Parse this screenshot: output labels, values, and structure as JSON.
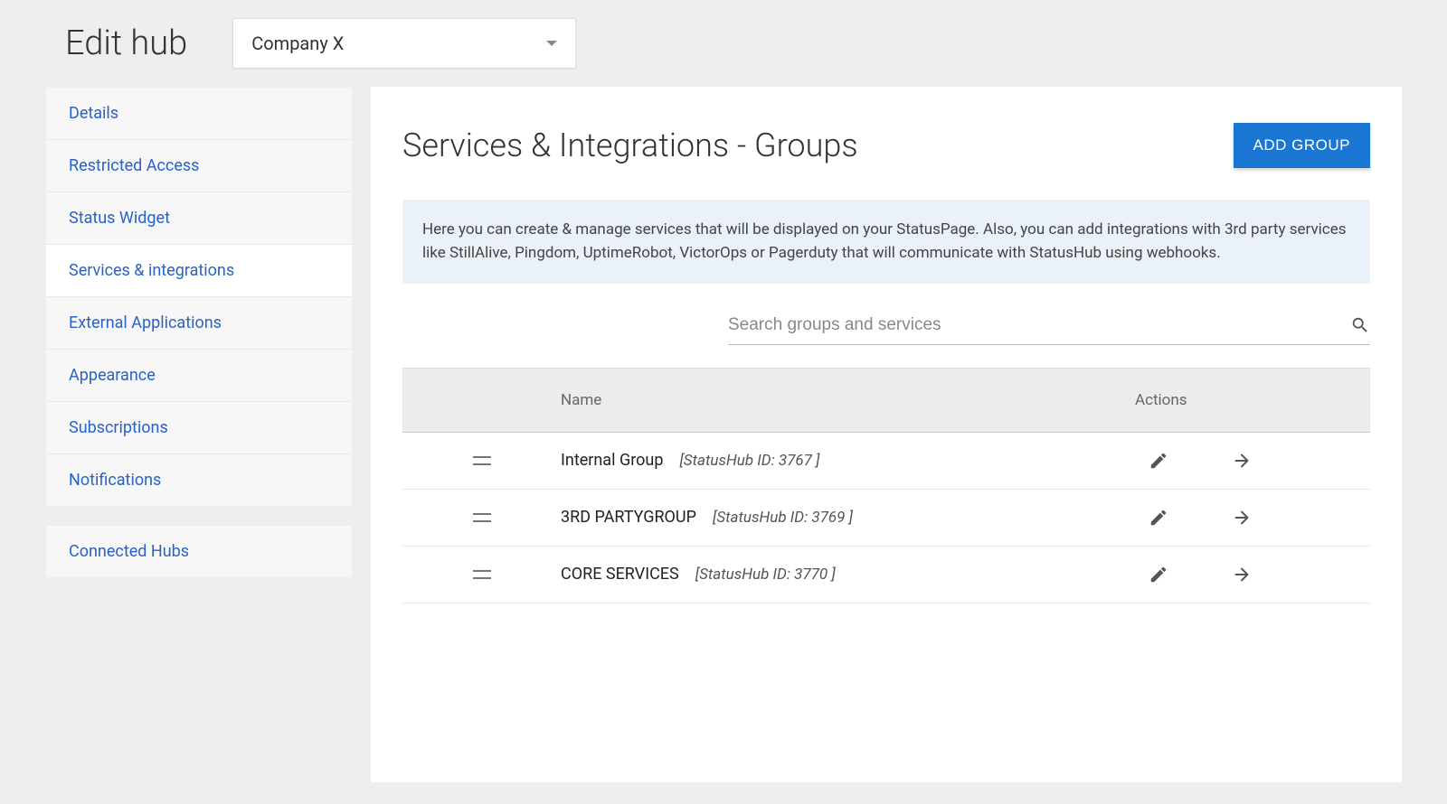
{
  "header": {
    "title": "Edit hub",
    "company": "Company X"
  },
  "sidebar": {
    "group1": [
      {
        "label": "Details",
        "active": false
      },
      {
        "label": "Restricted Access",
        "active": false
      },
      {
        "label": "Status Widget",
        "active": false
      },
      {
        "label": "Services & integrations",
        "active": true
      },
      {
        "label": "External Applications",
        "active": false
      },
      {
        "label": "Appearance",
        "active": false
      },
      {
        "label": "Subscriptions",
        "active": false
      },
      {
        "label": "Notifications",
        "active": false
      }
    ],
    "group2": [
      {
        "label": "Connected Hubs",
        "active": false
      }
    ]
  },
  "panel": {
    "title": "Services & Integrations - Groups",
    "add_button": "ADD GROUP",
    "info_text": "Here you can create & manage services that will be displayed on your StatusPage. Also, you can add integrations with 3rd party services like StillAlive, Pingdom, UptimeRobot, VictorOps or Pagerduty that will communicate with StatusHub using webhooks.",
    "search_placeholder": "Search groups and services",
    "table": {
      "headers": {
        "name": "Name",
        "actions": "Actions"
      },
      "rows": [
        {
          "name": "Internal Group",
          "id_label": "[StatusHub ID: 3767 ]"
        },
        {
          "name": "3RD PARTYGROUP",
          "id_label": "[StatusHub ID: 3769 ]"
        },
        {
          "name": "CORE SERVICES",
          "id_label": "[StatusHub ID: 3770 ]"
        }
      ]
    }
  }
}
